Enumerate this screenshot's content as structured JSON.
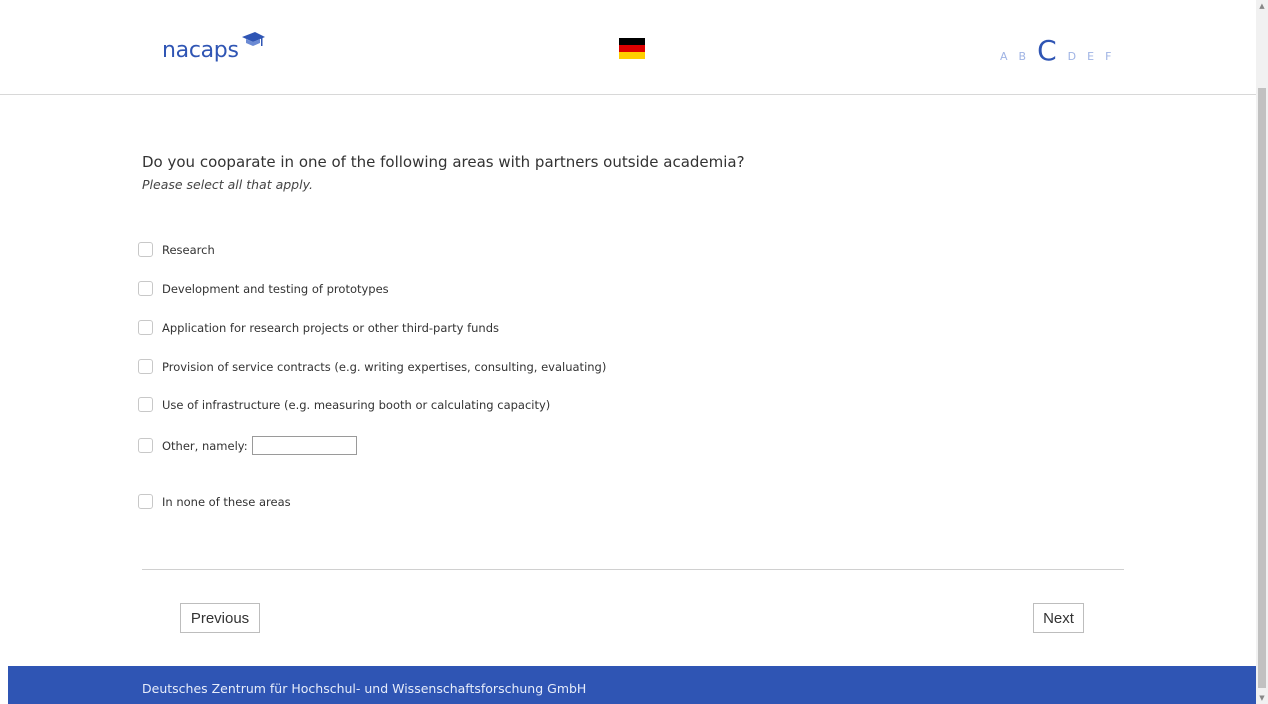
{
  "header": {
    "logo_text": "nacaps",
    "language_flag": "german-flag-icon",
    "steps": [
      "A",
      "B",
      "C",
      "D",
      "E",
      "F"
    ],
    "active_step": "C"
  },
  "question": {
    "text": "Do you cooparate in one of the following areas with partners outside academia?",
    "instruction": "Please select all that apply."
  },
  "options": [
    {
      "label": "Research",
      "checked": false
    },
    {
      "label": "Development and testing of prototypes",
      "checked": false
    },
    {
      "label": "Application for research projects or other third-party funds",
      "checked": false
    },
    {
      "label": "Provision of service contracts (e.g. writing expertises, consulting, evaluating)",
      "checked": false
    },
    {
      "label": "Use of infrastructure (e.g. measuring booth or calculating capacity)",
      "checked": false
    },
    {
      "label": "Other, namely:",
      "checked": false,
      "input_value": ""
    },
    {
      "label": "In none of these areas",
      "checked": false
    }
  ],
  "nav": {
    "previous_label": "Previous",
    "next_label": "Next"
  },
  "footer": {
    "text": "Deutsches Zentrum für Hochschul- und Wissenschaftsforschung GmbH"
  },
  "colors": {
    "brand_blue": "#2f55b4",
    "step_inactive": "#9fb3e4",
    "flag_black": "#000000",
    "flag_red": "#dd0000",
    "flag_gold": "#ffce00"
  }
}
